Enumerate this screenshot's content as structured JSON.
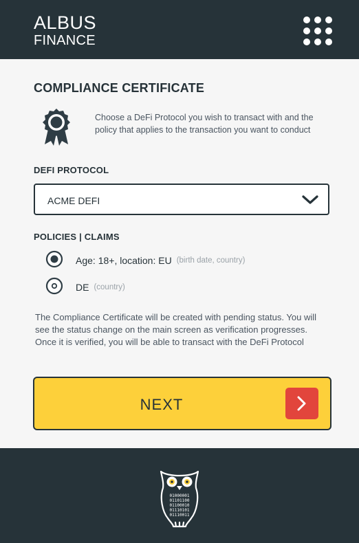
{
  "header": {
    "brand_line1": "ALBUS",
    "brand_line2": "FINANCE",
    "menu_icon": "grid-menu-icon"
  },
  "main": {
    "title": "COMPLIANCE CERTIFICATE",
    "intro": "Choose a DeFi Protocol you wish to transact with and the policy that applies to the transaction you want to conduct",
    "badge_icon": "certificate-badge-icon",
    "protocol_label": "DEFI PROTOCOL",
    "protocol_selected": "ACME DEFI",
    "policies_label": "POLICIES | CLAIMS",
    "policies": [
      {
        "label": "Age: 18+, location: EU",
        "hint": "(birth date, country)",
        "selected": true
      },
      {
        "label": "DE",
        "hint": "(country)",
        "selected": false
      }
    ],
    "note": "The Compliance Certificate will be created with pending status. You will see the status change on the main screen as verification progresses. Once it is verified, you will be able to  transact with the DeFi Protocol",
    "next_label": "NEXT"
  },
  "footer": {
    "logo_icon": "owl-logo-icon",
    "logo_digits": [
      "01000001",
      "01101100",
      "01100010",
      "01110101",
      "01110011"
    ]
  },
  "colors": {
    "dark": "#263339",
    "accent_yellow": "#fdd03a",
    "accent_red": "#e2453c"
  }
}
